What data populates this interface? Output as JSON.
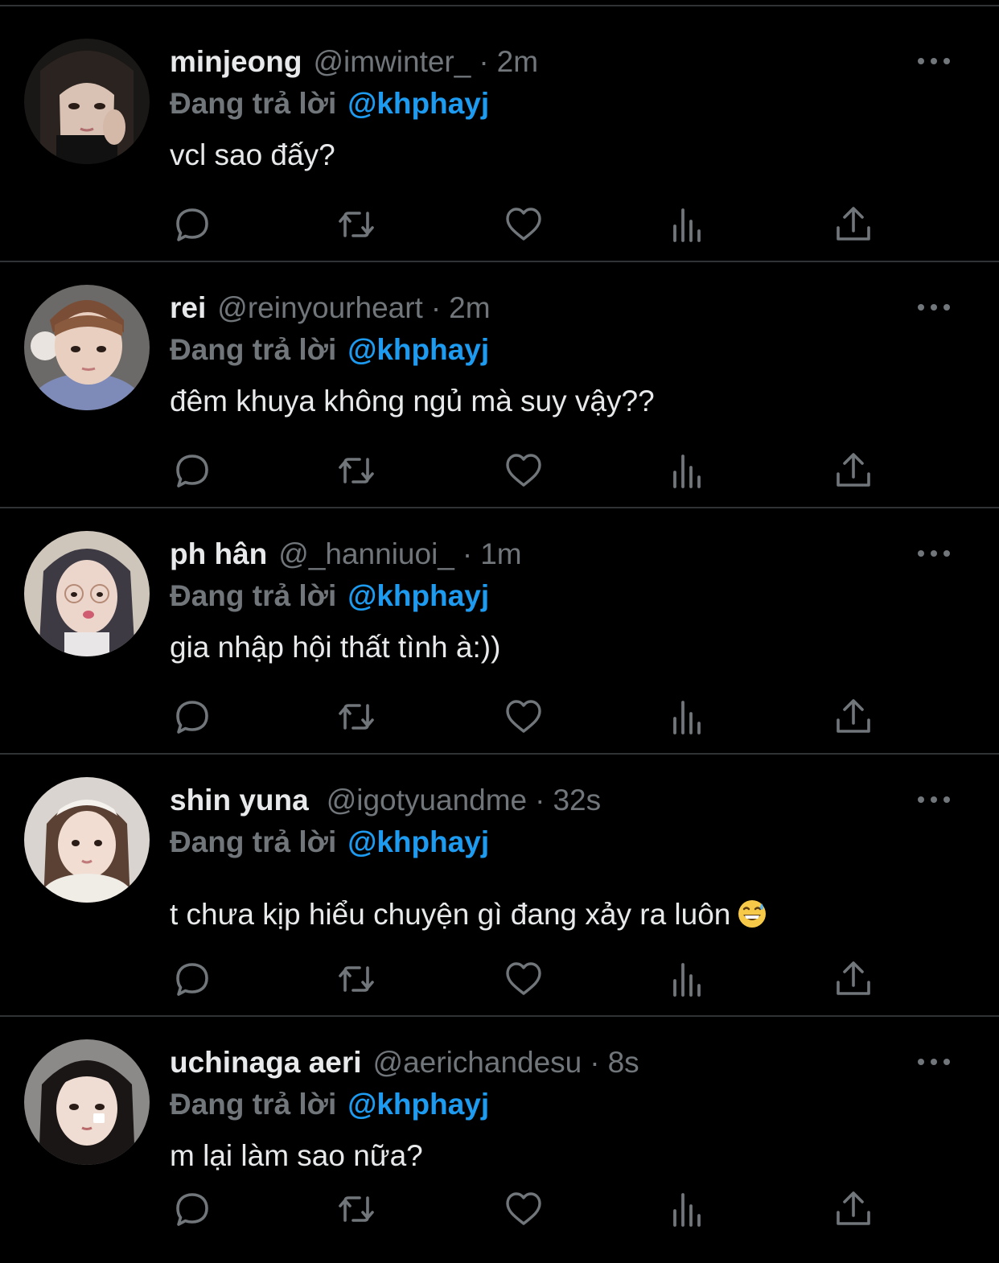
{
  "colors": {
    "background": "#000000",
    "divider": "#2f3336",
    "primary_text": "#e7e9ea",
    "secondary_text": "#71767b",
    "link": "#1d9bf0"
  },
  "tweets": [
    {
      "display_name": "minjeong",
      "handle": "@imwinter_",
      "separator": "·",
      "time": "2m",
      "reply_prefix": "Đang trả lời",
      "reply_to": "@khphayj",
      "text": "vcl sao đấy?",
      "emoji": ""
    },
    {
      "display_name": "rei",
      "handle": "@reinyourheart",
      "separator": "·",
      "time": "2m",
      "reply_prefix": "Đang trả lời",
      "reply_to": "@khphayj",
      "text": "đêm khuya không ngủ mà suy vậy??",
      "emoji": ""
    },
    {
      "display_name": "ph hân",
      "handle": "@_hanniuoi_",
      "separator": "·",
      "time": "1m",
      "reply_prefix": "Đang trả lời",
      "reply_to": "@khphayj",
      "text": "gia nhập hội thất tình à:))",
      "emoji": ""
    },
    {
      "display_name": "shin yuna",
      "handle": "@igotyuandme",
      "separator": "·",
      "time": "32s",
      "reply_prefix": "Đang trả lời",
      "reply_to": "@khphayj",
      "text": "t chưa kịp hiểu chuyện gì đang xảy ra luôn",
      "emoji": "grinning-sweat-emoji"
    },
    {
      "display_name": "uchinaga aeri",
      "handle": "@aerichandesu",
      "separator": "·",
      "time": "8s",
      "reply_prefix": "Đang trả lời",
      "reply_to": "@khphayj",
      "text": "m lại làm sao nữa?",
      "emoji": ""
    }
  ],
  "action_icons": [
    "reply-icon",
    "retweet-icon",
    "like-icon",
    "views-icon",
    "share-icon"
  ],
  "more_icon": "more-options-icon"
}
